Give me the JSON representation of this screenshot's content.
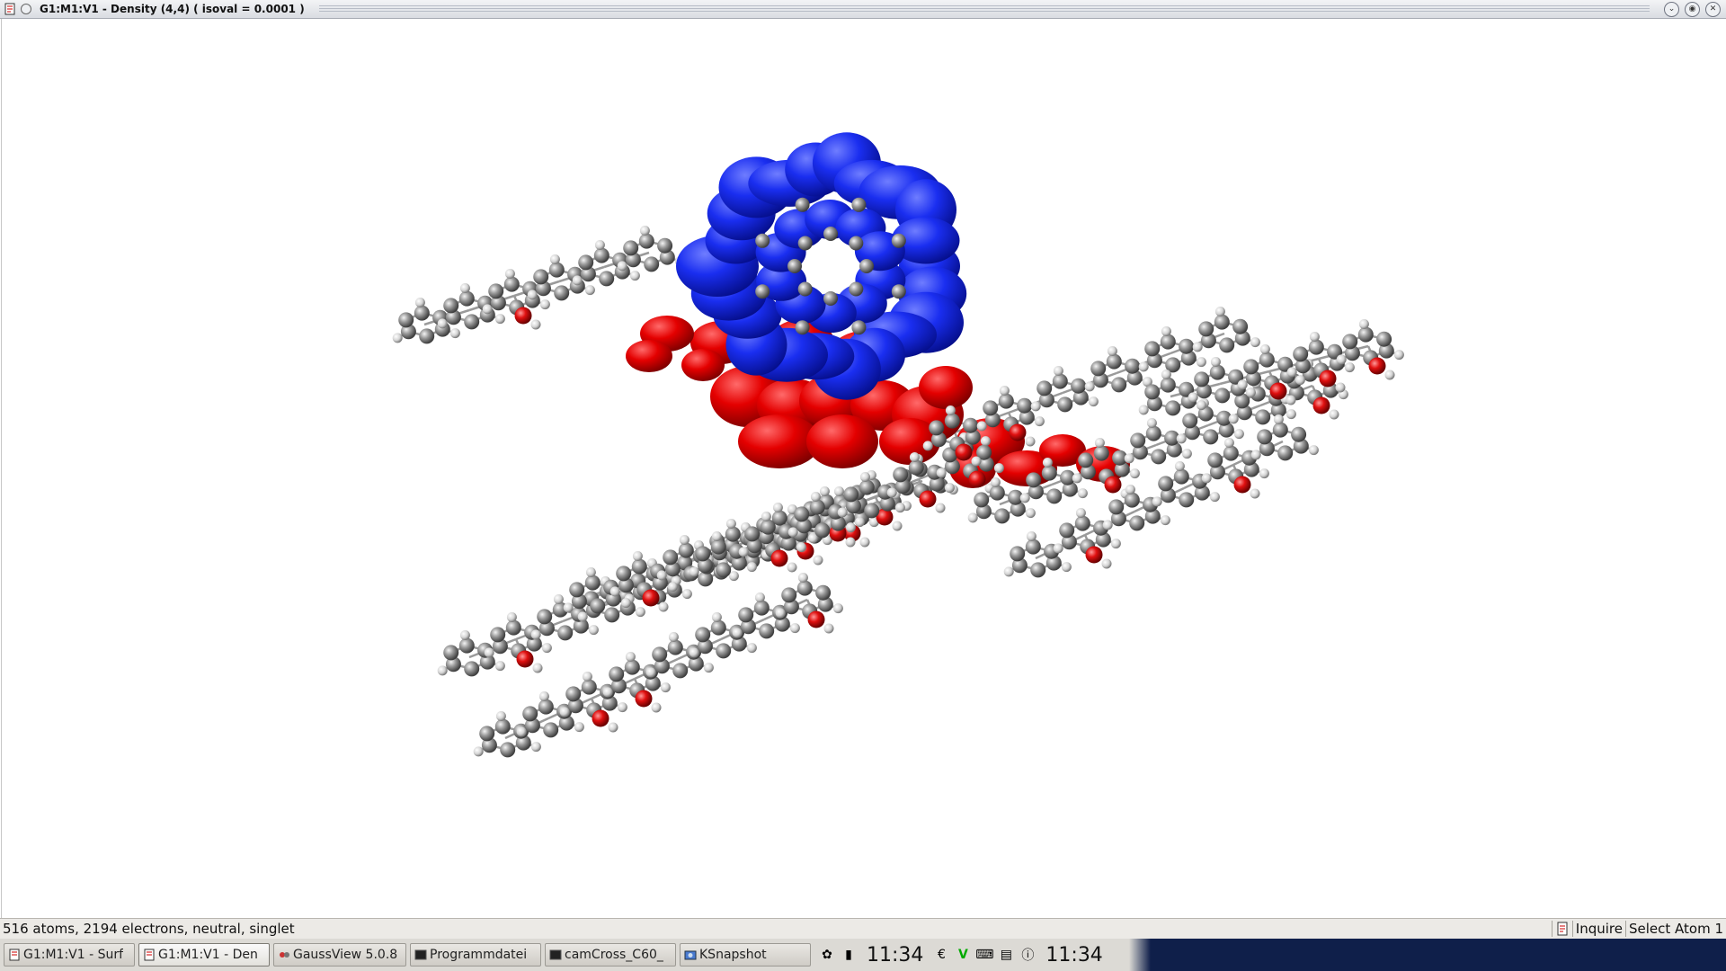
{
  "window": {
    "title": "G1:M1:V1 - Density (4,4) ( isoval = 0.0001 )",
    "buttons": [
      "minimize-icon",
      "maximize-icon",
      "close-icon"
    ]
  },
  "viewport": {
    "content": "molecular-model",
    "colors": {
      "positive_density": "#1428e6",
      "negative_density": "#e00000",
      "carbon": "#8a8a8a",
      "hydrogen": "#e6e6e6",
      "oxygen": "#d01010"
    }
  },
  "status": {
    "info": "516 atoms, 2194 electrons, neutral, singlet",
    "mode": "Inquire",
    "action": "Select Atom 1"
  },
  "taskbar": {
    "tasks": [
      {
        "label": "G1:M1:V1 - Surf",
        "icon": "gaussview-doc-icon",
        "active": false
      },
      {
        "label": "G1:M1:V1 - Den",
        "icon": "gaussview-doc-icon",
        "active": true
      },
      {
        "label": "GaussView 5.0.8",
        "icon": "gaussview-icon",
        "active": false
      },
      {
        "label": "Programmdatei",
        "icon": "terminal-icon",
        "active": false
      },
      {
        "label": "camCross_C60_",
        "icon": "terminal-icon",
        "active": false
      },
      {
        "label": "KSnapshot",
        "icon": "ksnapshot-icon",
        "active": false
      }
    ],
    "clock1": "11:34",
    "clock2": "11:34"
  }
}
